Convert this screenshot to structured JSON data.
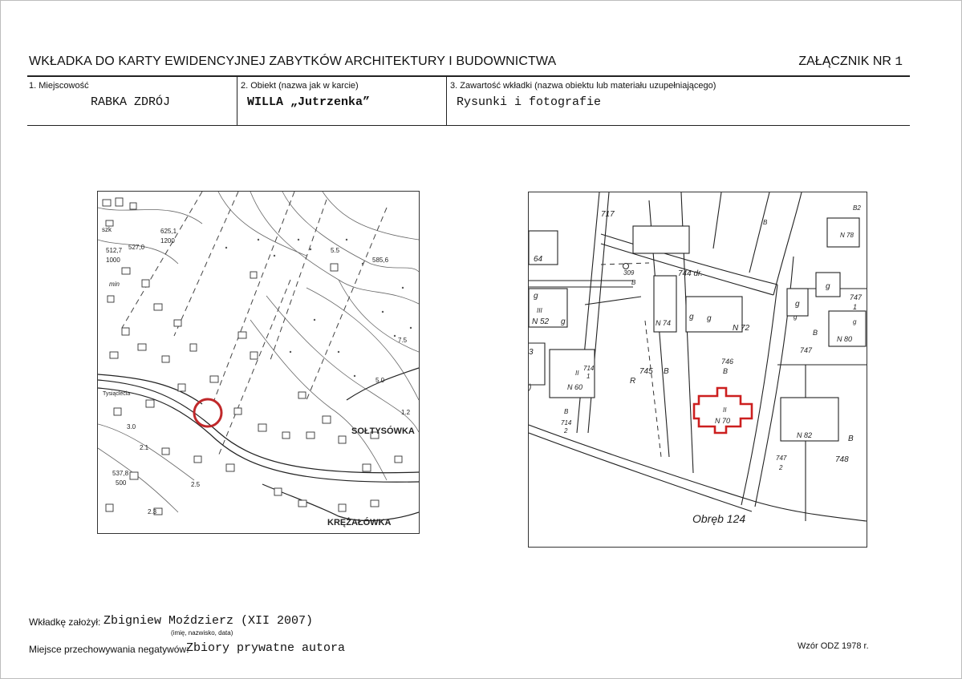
{
  "header": {
    "title": "WKŁADKA DO KARTY EWIDENCYJNEJ ZABYTKÓW ARCHITEKTURY I BUDOWNICTWA",
    "annex_label": "ZAŁĄCZNIK NR",
    "annex_number": "1"
  },
  "fields": [
    {
      "label": "1. Miejscowość",
      "value": "RABKA ZDRÓJ"
    },
    {
      "label": "2. Obiekt (nazwa jak w karcie)",
      "value": "WILLA „Jutrzenka”"
    },
    {
      "label": "3. Zawartość wkładki (nazwa obiektu lub materiału uzupełniającego)",
      "value": "Rysunki i fotografie"
    }
  ],
  "topo_map": {
    "labels": {
      "szk": "szk",
      "h6251": "625,1",
      "h1200": "1200",
      "h5270": "527,0",
      "h5127": "512,7",
      "h1000": "1000",
      "min": "min",
      "h55": "5.5",
      "h5856": "585,6",
      "street": "Tysiąclecia",
      "h75": "7.5",
      "h50": "5.0",
      "h30": "3.0",
      "h21": "2.1",
      "h5378": "537,8",
      "h500": "500",
      "h23": "2.3",
      "h25": "2.5",
      "h12": "1.2",
      "soltysowka": "SOŁTYSÓWKA",
      "krezalowka": "KRĘŻAŁÓWKA"
    },
    "marker_color": "#c0282a"
  },
  "cadastral_map": {
    "labels": {
      "p717": "717",
      "p64": "64",
      "p309": "309",
      "b309": "B",
      "dr": "744 dr.",
      "b_top": "B",
      "b2": "B2",
      "n78": "N 78",
      "g1": "g",
      "p747": "747",
      "p747_den": "1",
      "g_left": "g",
      "iii": "III",
      "n52": "N 52",
      "g_left2": "g",
      "n74": "N 74",
      "g2": "g",
      "g3": "g",
      "n72": "N 72",
      "g4": "g",
      "g5": "g",
      "b_right": "B",
      "n80": "N 80",
      "g6": "g",
      "p747b": "747",
      "p13": "3",
      "p746": "746",
      "b746": "B",
      "ii1": "II",
      "p714": "714",
      "p714_den": "1",
      "n60": "N 60",
      "p745": "745",
      "b745": "B",
      "r745": "R",
      "ii70": "II",
      "n70": "N 70",
      "b714": "B",
      "p714b": "714",
      "p714b_den": "2",
      "n82": "N 82",
      "b82": "B",
      "p7472": "747",
      "p7472_den": "2",
      "p748": "748",
      "paren": ")",
      "obreb": "Obręb 124"
    },
    "highlight_color": "#cc1f1f"
  },
  "footer": {
    "created_label": "Wkładkę założył:",
    "created_value": "Zbigniew Moździerz (XII 2007)",
    "created_hint": "(imię, nazwisko, data)",
    "storage_label": "Miejsce przechowywania negatywów:",
    "storage_value": "Zbiory prywatne autora",
    "form_no": "Wzór ODZ 1978 r."
  }
}
